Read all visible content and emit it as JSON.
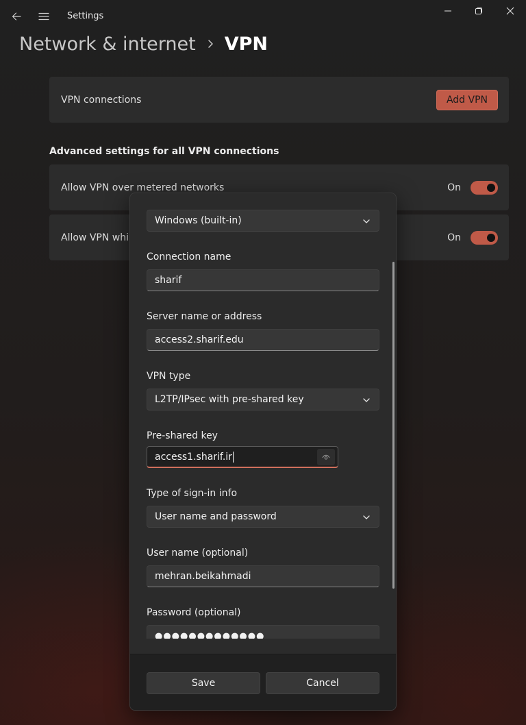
{
  "titlebar": {
    "app_title": "Settings",
    "back_icon": "back-arrow-icon",
    "menu_icon": "hamburger-menu-icon",
    "minimize_icon": "minimize-icon",
    "maximize_icon": "maximize-icon",
    "close_icon": "close-icon"
  },
  "breadcrumb": {
    "parent": "Network & internet",
    "current": "VPN"
  },
  "vpn_connections": {
    "label": "VPN connections",
    "add_button": "Add VPN"
  },
  "advanced": {
    "heading": "Advanced settings for all VPN connections",
    "metered": {
      "label": "Allow VPN over metered networks",
      "state": "On",
      "enabled": true
    },
    "roaming": {
      "label": "Allow VPN while",
      "state": "On",
      "enabled": true
    }
  },
  "dialog": {
    "provider": {
      "value": "Windows (built-in)"
    },
    "connection_name": {
      "label": "Connection name",
      "value": "sharif"
    },
    "server": {
      "label": "Server name or address",
      "value": "access2.sharif.edu"
    },
    "vpn_type": {
      "label": "VPN type",
      "value": "L2TP/IPsec with pre-shared key"
    },
    "preshared_key": {
      "label": "Pre-shared key",
      "value": "access1.sharif.ir"
    },
    "signin_type": {
      "label": "Type of sign-in info",
      "value": "User name and password"
    },
    "username": {
      "label": "User name (optional)",
      "value": "mehran.beikahmadi"
    },
    "password": {
      "label": "Password (optional)",
      "value": "●●●●●●●●●●●●●"
    },
    "save_label": "Save",
    "cancel_label": "Cancel"
  },
  "colors": {
    "accent": "#c05a48",
    "focus_underline": "#d06f5c",
    "card_bg": "#2c2c2c",
    "dialog_bg": "#2b2b2b"
  }
}
